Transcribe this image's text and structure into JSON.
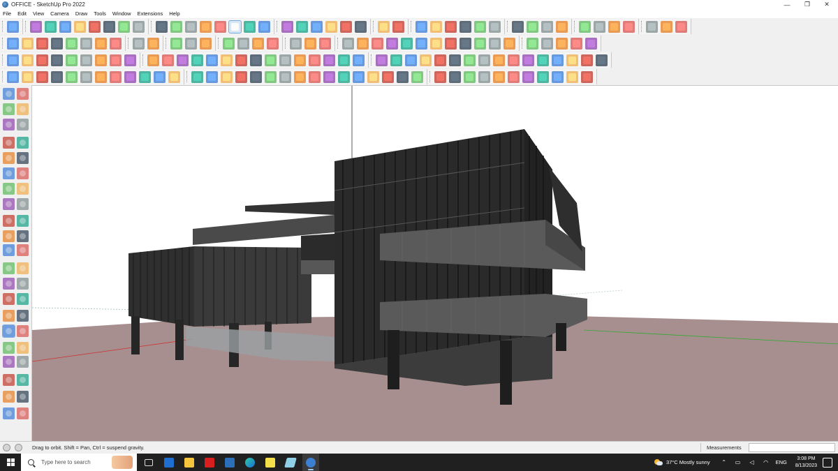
{
  "window": {
    "title": "OFFICE - SketchUp Pro 2022",
    "minimize_glyph": "—",
    "restore_glyph": "❐",
    "close_glyph": "✕"
  },
  "menu": [
    "File",
    "Edit",
    "View",
    "Camera",
    "Draw",
    "Tools",
    "Window",
    "Extensions",
    "Help"
  ],
  "status": {
    "hint": "Drag to orbit.  Shift = Pan, Ctrl = suspend gravity.",
    "measurements_label": "Measurements",
    "measurements_value": ""
  },
  "taskbar": {
    "search_placeholder": "Type here to search",
    "apps": [
      "task-view",
      "calculator",
      "file-explorer",
      "acrobat",
      "photoshop",
      "edge",
      "sticky-notes",
      "sketchup-layout",
      "sketchup"
    ],
    "weather": "37°C  Mostly sunny",
    "language": "ENG",
    "time": "3:08 PM",
    "date": "8/13/2023"
  },
  "colors": {
    "ground": "#a89090",
    "building_dark": "#2b2b2b",
    "panel_gray": "#555555",
    "accent": "#4d90d8"
  }
}
